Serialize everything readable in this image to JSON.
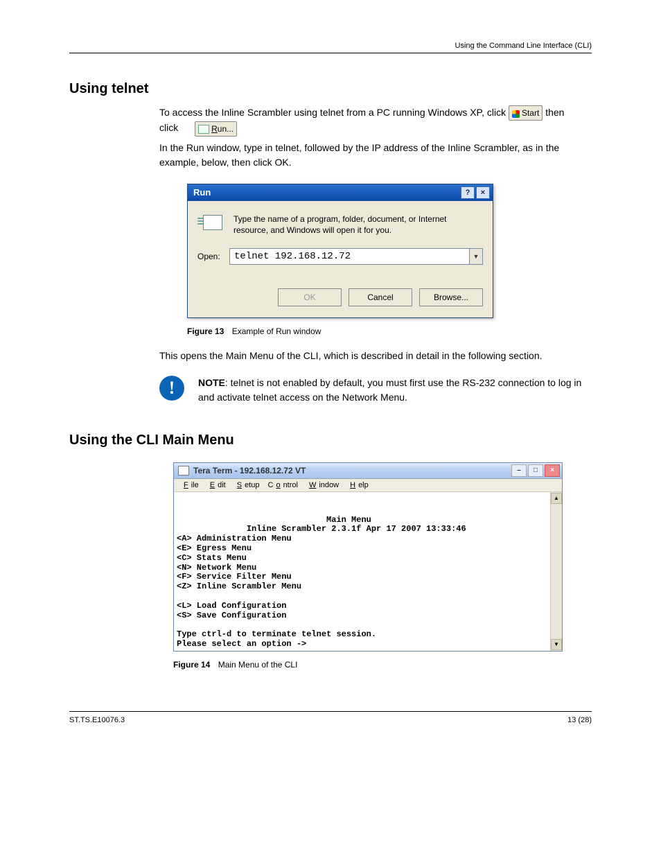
{
  "header_right": "Using the Command Line Interface (CLI)",
  "section1": {
    "title": "Using telnet",
    "para1_a": "To access the Inline Scrambler using telnet from a PC running Windows XP, click ",
    "start_label": "Start",
    "para1_b": " then click",
    "run_label": "Run...",
    "para2": "In the Run window, type in telnet, followed by the IP address of the Inline Scrambler, as in the example, below, then click OK."
  },
  "run_dialog": {
    "title": "Run",
    "desc": "Type the name of a program, folder, document, or Internet resource, and Windows will open it for you.",
    "open_label": "Open:",
    "open_value": "telnet 192.168.12.72",
    "btn_ok": "OK",
    "btn_cancel": "Cancel",
    "btn_browse": "Browse..."
  },
  "fig1": {
    "lead": "Figure 13",
    "text": "Example of Run window"
  },
  "after_fig1": "This opens the Main Menu of the CLI, which is described in detail in the following section.",
  "note": {
    "lead": "NOTE",
    "text": ": telnet is not enabled by default, you must first use the RS-232 connection to log in and activate telnet access on the Network Menu."
  },
  "section2": {
    "title": "Using the CLI Main Menu"
  },
  "tt": {
    "title": "Tera Term - 192.168.12.72 VT",
    "menus": [
      "File",
      "Edit",
      "Setup",
      "Control",
      "Window",
      "Help"
    ],
    "menu_underline_index": [
      0,
      0,
      0,
      0,
      0,
      0
    ]
  },
  "chart_data": {
    "type": "table",
    "title": "Main Menu",
    "subtitle": "Inline Scrambler 2.3.1f Apr 17 2007 13:33:46",
    "rows": [
      {
        "key": "<A>",
        "label": "Administration Menu"
      },
      {
        "key": "<E>",
        "label": "Egress Menu"
      },
      {
        "key": "<C>",
        "label": "Stats Menu"
      },
      {
        "key": "<N>",
        "label": "Network Menu"
      },
      {
        "key": "<F>",
        "label": "Service Filter Menu"
      },
      {
        "key": "<Z>",
        "label": "Inline Scrambler Menu"
      },
      {
        "key": "<L>",
        "label": "Load Configuration"
      },
      {
        "key": "<S>",
        "label": "Save Configuration"
      }
    ],
    "footer_lines": [
      "Type ctrl-d to terminate telnet session.",
      "Please select an option ->"
    ]
  },
  "fig2": {
    "lead": "Figure 14",
    "text": "Main Menu of the CLI"
  },
  "footer": {
    "doc": "ST.TS.E10076.3",
    "page": "13 (28)"
  }
}
